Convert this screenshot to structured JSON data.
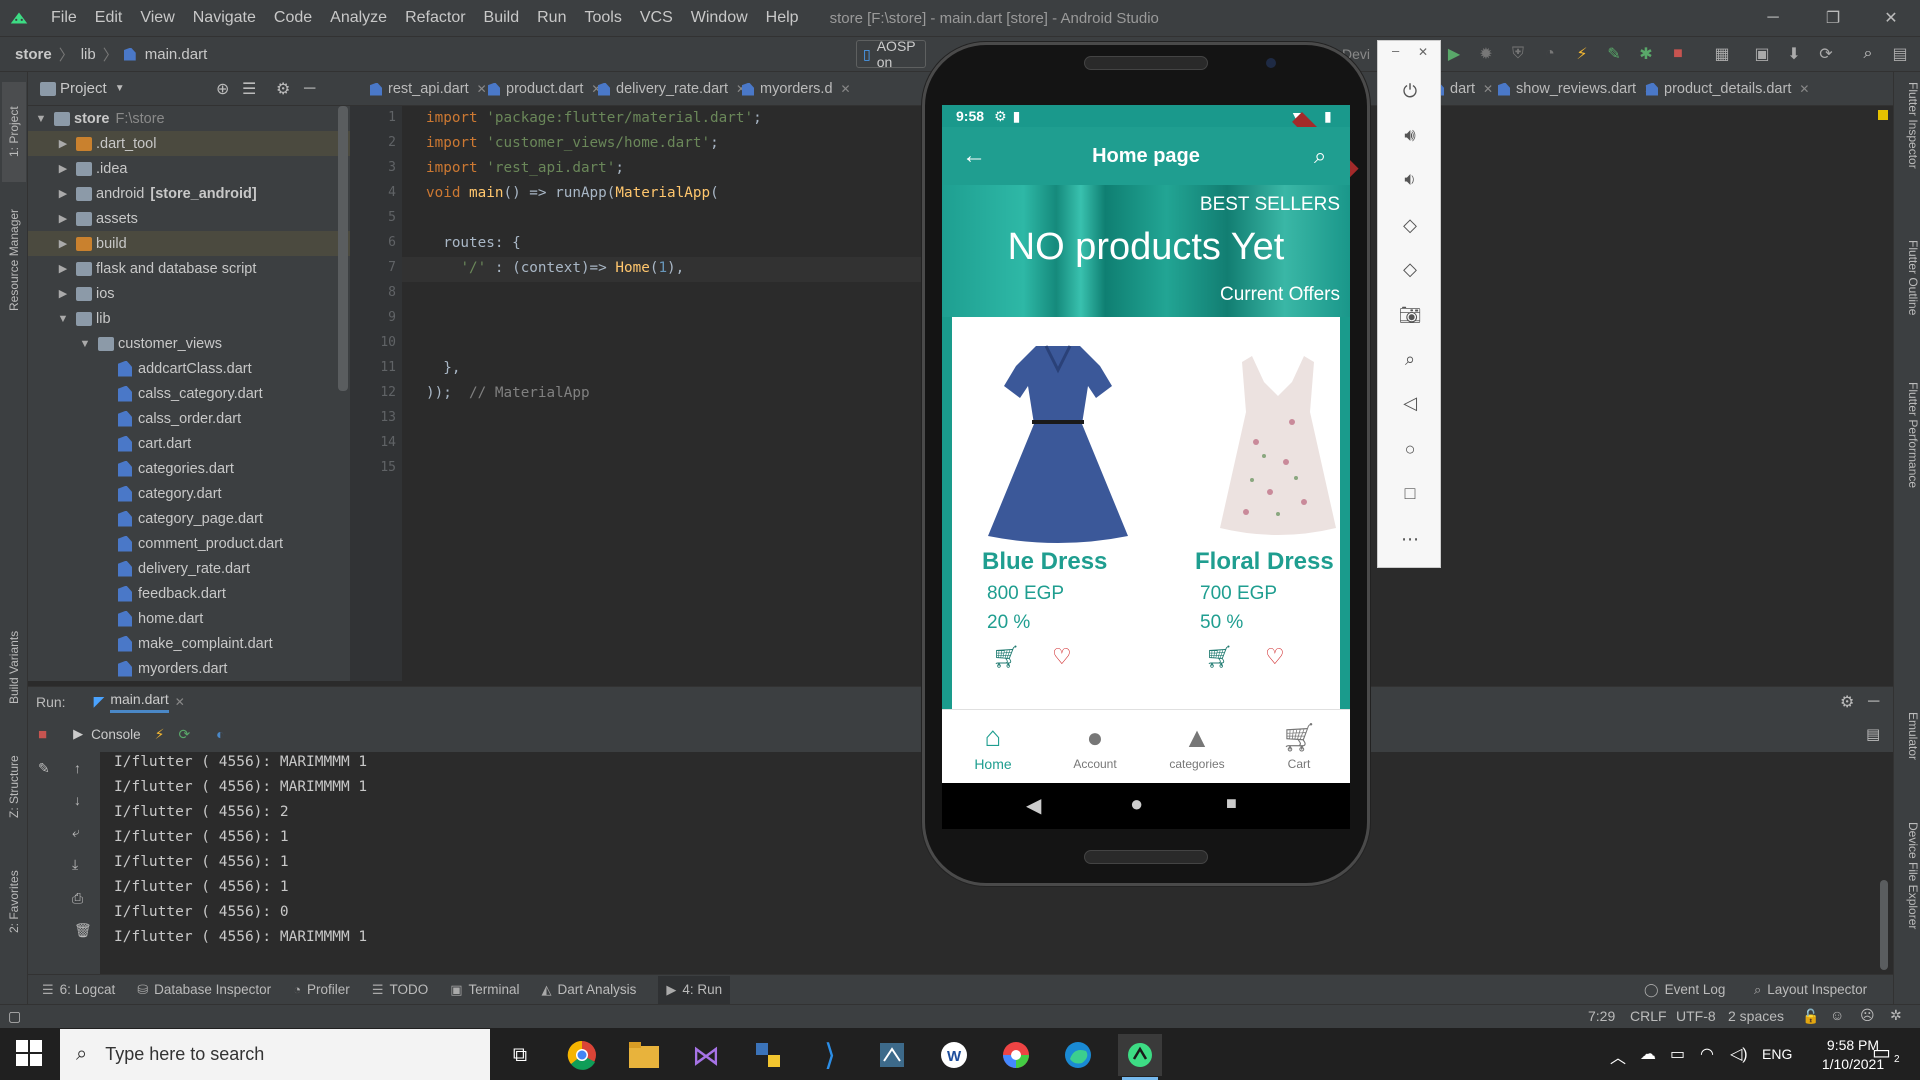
{
  "window": {
    "menu": [
      "File",
      "Edit",
      "View",
      "Navigate",
      "Code",
      "Analyze",
      "Refactor",
      "Build",
      "Run",
      "Tools",
      "VCS",
      "Window",
      "Help"
    ],
    "title": "store [F:\\store] - main.dart [store] - Android Studio"
  },
  "breadcrumb": {
    "project": "store",
    "folder": "lib",
    "file": "main.dart"
  },
  "toolbar": {
    "device": "AOSP on",
    "device_right": "Devi"
  },
  "project_panel": {
    "title": "Project",
    "root": {
      "name": "store",
      "path": "F:\\store"
    },
    "items": [
      {
        "label": ".dart_tool",
        "type": "folder-orange",
        "depth": 1,
        "arrow": "▶"
      },
      {
        "label": ".idea",
        "type": "folder",
        "depth": 1,
        "arrow": "▶"
      },
      {
        "label": "android",
        "suffix": "[store_android]",
        "type": "folder",
        "depth": 1,
        "arrow": "▶"
      },
      {
        "label": "assets",
        "type": "folder",
        "depth": 1,
        "arrow": "▶"
      },
      {
        "label": "build",
        "type": "folder-orange",
        "depth": 1,
        "arrow": "▶"
      },
      {
        "label": "flask and database script",
        "type": "folder",
        "depth": 1,
        "arrow": "▶"
      },
      {
        "label": "ios",
        "type": "folder",
        "depth": 1,
        "arrow": "▶"
      },
      {
        "label": "lib",
        "type": "folder",
        "depth": 1,
        "arrow": "▼"
      },
      {
        "label": "customer_views",
        "type": "folder",
        "depth": 2,
        "arrow": "▼"
      },
      {
        "label": "addcartClass.dart",
        "type": "dart",
        "depth": 3
      },
      {
        "label": "calss_category.dart",
        "type": "dart",
        "depth": 3
      },
      {
        "label": "calss_order.dart",
        "type": "dart",
        "depth": 3
      },
      {
        "label": "cart.dart",
        "type": "dart",
        "depth": 3
      },
      {
        "label": "categories.dart",
        "type": "dart",
        "depth": 3
      },
      {
        "label": "category.dart",
        "type": "dart",
        "depth": 3
      },
      {
        "label": "category_page.dart",
        "type": "dart",
        "depth": 3
      },
      {
        "label": "comment_product.dart",
        "type": "dart",
        "depth": 3
      },
      {
        "label": "delivery_rate.dart",
        "type": "dart",
        "depth": 3
      },
      {
        "label": "feedback.dart",
        "type": "dart",
        "depth": 3
      },
      {
        "label": "home.dart",
        "type": "dart",
        "depth": 3
      },
      {
        "label": "make_complaint.dart",
        "type": "dart",
        "depth": 3
      },
      {
        "label": "myorders.dart",
        "type": "dart",
        "depth": 3
      }
    ]
  },
  "editor_tabs": [
    "rest_api.dart",
    "product.dart",
    "delivery_rate.dart",
    "myorders.d",
    "dart",
    "show_reviews.dart",
    "product_details.dart"
  ],
  "code": {
    "line_numbers": [
      "1",
      "2",
      "3",
      "4",
      "5",
      "6",
      "7",
      "8",
      "9",
      "10",
      "11",
      "12",
      "13",
      "14",
      "15"
    ],
    "l1_kw": "import",
    "l1_str": "'package:flutter/material.dart'",
    "l1_end": ";",
    "l2_kw": "import",
    "l2_str": "'customer_views/home.dart'",
    "l2_end": ";",
    "l3_kw": "import",
    "l3_str": "'rest_api.dart'",
    "l3_end": ";",
    "l4_kw": "void",
    "l4_fn": "main",
    "l4_mid": "() => runApp(",
    "l4_cls": "MaterialApp",
    "l4_end": "(",
    "l6": "  routes: {",
    "l7_a": "    ",
    "l7_str": "'/'",
    "l7_b": " : (context)=> ",
    "l7_cls": "Home",
    "l7_c": "(",
    "l7_num": "1",
    "l7_d": "),",
    "l11": "  },",
    "l12_a": "));  ",
    "l12_cm": "// MaterialApp"
  },
  "run_panel": {
    "label": "Run:",
    "tab": "main.dart",
    "console_label": "Console",
    "lines": [
      "I/flutter ( 4556): MARIMMMM 1",
      "I/flutter ( 4556): MARIMMMM 1",
      "I/flutter ( 4556): 2",
      "I/flutter ( 4556): 1",
      "I/flutter ( 4556): 1",
      "I/flutter ( 4556): 1",
      "I/flutter ( 4556): 0",
      "I/flutter ( 4556): MARIMMMM 1"
    ]
  },
  "tool_windows": {
    "logcat": "6: Logcat",
    "db": "Database Inspector",
    "profiler": "Profiler",
    "todo": "TODO",
    "terminal": "Terminal",
    "dart": "Dart Analysis",
    "run": "4: Run",
    "eventlog": "Event Log",
    "layout": "Layout Inspector"
  },
  "left_tabs": {
    "project": "1: Project",
    "resource": "Resource Manager",
    "variants": "Build Variants",
    "structure": "Z: Structure",
    "favorites": "2: Favorites"
  },
  "right_tabs": {
    "inspector": "Flutter Inspector",
    "outline": "Flutter Outline",
    "performance": "Flutter Performance",
    "emulator": "Emulator",
    "device": "Device File Explorer"
  },
  "status": {
    "position": "7:29",
    "line_sep": "CRLF",
    "encoding": "UTF-8",
    "indent": "2 spaces"
  },
  "phone": {
    "time": "9:58",
    "app_title": "Home page",
    "debug": "DEBUG",
    "banner": {
      "best": "BEST SELLERS",
      "headline": "NO products Yet",
      "offers": "Current Offers"
    },
    "products": [
      {
        "name": "Blue Dress",
        "price": "800 EGP",
        "discount": "20 %",
        "color": "#3a5898"
      },
      {
        "name": "Floral Dress",
        "price": "700 EGP",
        "discount": "50 %",
        "color": "#e9dfdd"
      }
    ],
    "nav": [
      {
        "label": "Home",
        "icon": "home-icon",
        "active": true
      },
      {
        "label": "Account",
        "icon": "person-icon",
        "active": false
      },
      {
        "label": "categories",
        "icon": "category-icon",
        "active": false
      },
      {
        "label": "Cart",
        "icon": "cart-icon",
        "active": false
      }
    ],
    "accent": "#1f9e90"
  },
  "taskbar": {
    "search_placeholder": "Type here to search",
    "lang": "ENG",
    "time": "9:58 PM",
    "date": "1/10/2021",
    "notification_count": "2"
  }
}
